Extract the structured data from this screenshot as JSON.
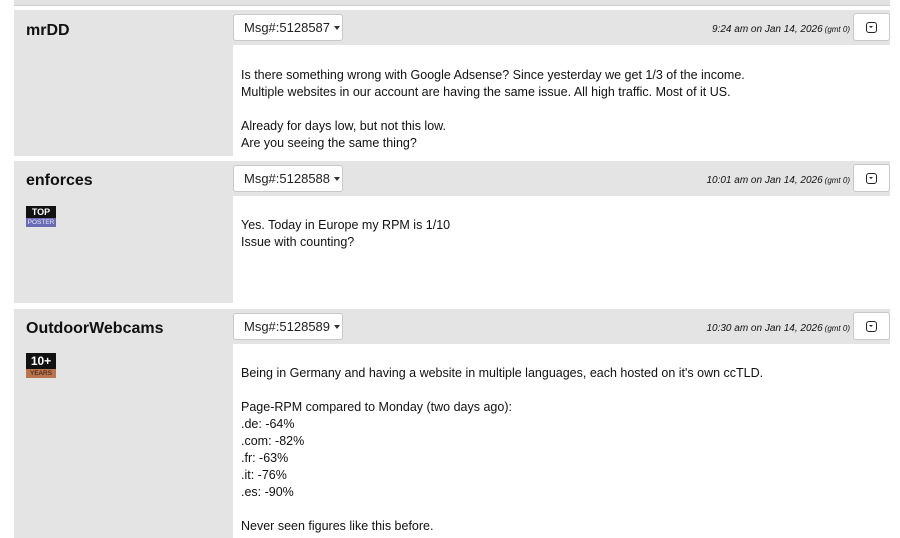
{
  "posts": [
    {
      "author": "mrDD",
      "msg_label": "Msg#:5128587",
      "timestamp": "9:24 am on Jan 14, 2026",
      "gmt": "(gmt 0)",
      "lines": [
        "Is there something wrong with Google Adsense? Since yesterday we get 1/3 of the income.",
        "Multiple websites in our account are having the same issue. All high traffic. Most of it US.",
        "",
        "Already for days low, but not this low.",
        "Are you seeing the same thing?"
      ]
    },
    {
      "author": "enforces",
      "badge": {
        "top": "TOP",
        "bottom": "POSTER"
      },
      "msg_label": "Msg#:5128588",
      "timestamp": "10:01 am on Jan 14, 2026",
      "gmt": "(gmt 0)",
      "lines": [
        "Yes. Today in Europe my RPM is 1/10",
        "Issue with counting?"
      ]
    },
    {
      "author": "OutdoorWebcams",
      "badge": {
        "top": "10+",
        "bottom": "YEARS"
      },
      "msg_label": "Msg#:5128589",
      "timestamp": "10:30 am on Jan 14, 2026",
      "gmt": "(gmt 0)",
      "lines": [
        "Being in Germany and having a website in multiple languages, each hosted on it's own ccTLD.",
        "",
        "Page-RPM compared to Monday (two days ago):",
        ".de: -64%",
        ".com: -82%",
        ".fr: -63%",
        ".it: -76%",
        ".es: -90%",
        "",
        "Never seen figures like this before."
      ]
    }
  ]
}
